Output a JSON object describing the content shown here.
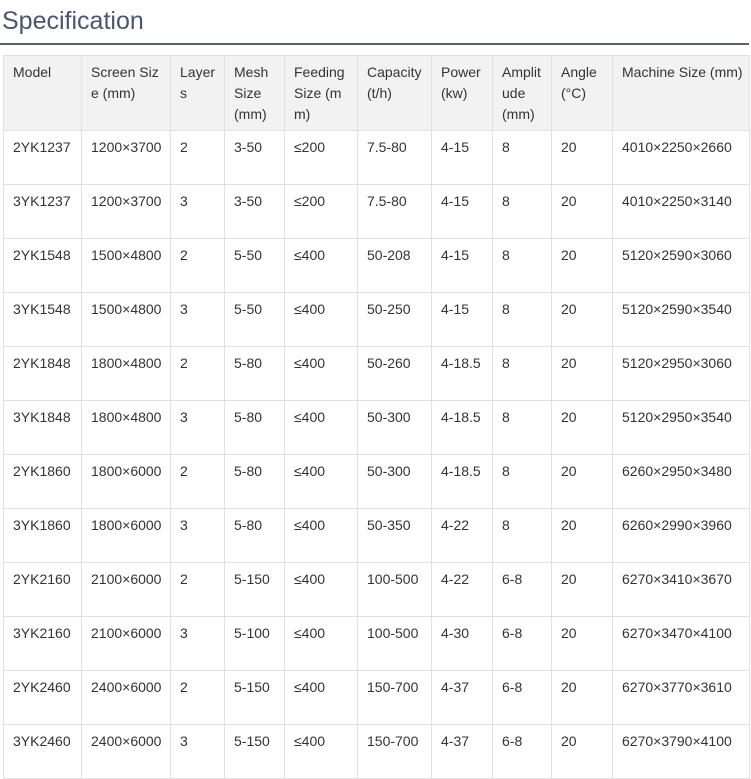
{
  "page": {
    "title": "Specification"
  },
  "table": {
    "headers": [
      "Model",
      "Screen Size (mm)",
      "Layers",
      "Mesh Size (mm)",
      "Feeding Size (mm)",
      "Capacity (t/h)",
      "Power (kw)",
      "Amplitude (mm)",
      "Angle (°C)",
      "Machine Size (mm)"
    ],
    "rows": [
      [
        "2YK1237",
        "1200×3700",
        "2",
        "3-50",
        "≤200",
        "7.5-80",
        "4-15",
        "8",
        "20",
        "4010×2250×2660"
      ],
      [
        "3YK1237",
        "1200×3700",
        "3",
        "3-50",
        "≤200",
        "7.5-80",
        "4-15",
        "8",
        "20",
        "4010×2250×3140"
      ],
      [
        "2YK1548",
        "1500×4800",
        "2",
        "5-50",
        "≤400",
        "50-208",
        "4-15",
        "8",
        "20",
        "5120×2590×3060"
      ],
      [
        "3YK1548",
        "1500×4800",
        "3",
        "5-50",
        "≤400",
        "50-250",
        "4-15",
        "8",
        "20",
        "5120×2590×3540"
      ],
      [
        "2YK1848",
        "1800×4800",
        "2",
        "5-80",
        "≤400",
        "50-260",
        "4-18.5",
        "8",
        "20",
        "5120×2950×3060"
      ],
      [
        "3YK1848",
        "1800×4800",
        "3",
        "5-80",
        "≤400",
        "50-300",
        "4-18.5",
        "8",
        "20",
        "5120×2950×3540"
      ],
      [
        "2YK1860",
        "1800×6000",
        "2",
        "5-80",
        "≤400",
        "50-300",
        "4-18.5",
        "8",
        "20",
        "6260×2950×3480"
      ],
      [
        "3YK1860",
        "1800×6000",
        "3",
        "5-80",
        "≤400",
        "50-350",
        "4-22",
        "8",
        "20",
        "6260×2990×3960"
      ],
      [
        "2YK2160",
        "2100×6000",
        "2",
        "5-150",
        "≤400",
        "100-500",
        "4-22",
        "6-8",
        "20",
        "6270×3410×3670"
      ],
      [
        "3YK2160",
        "2100×6000",
        "3",
        "5-100",
        "≤400",
        "100-500",
        "4-30",
        "6-8",
        "20",
        "6270×3470×4100"
      ],
      [
        "2YK2460",
        "2400×6000",
        "2",
        "5-150",
        "≤400",
        "150-700",
        "4-37",
        "6-8",
        "20",
        "6270×3770×3610"
      ],
      [
        "3YK2460",
        "2400×6000",
        "3",
        "5-150",
        "≤400",
        "150-700",
        "4-37",
        "6-8",
        "20",
        "6270×3790×4100"
      ]
    ]
  }
}
